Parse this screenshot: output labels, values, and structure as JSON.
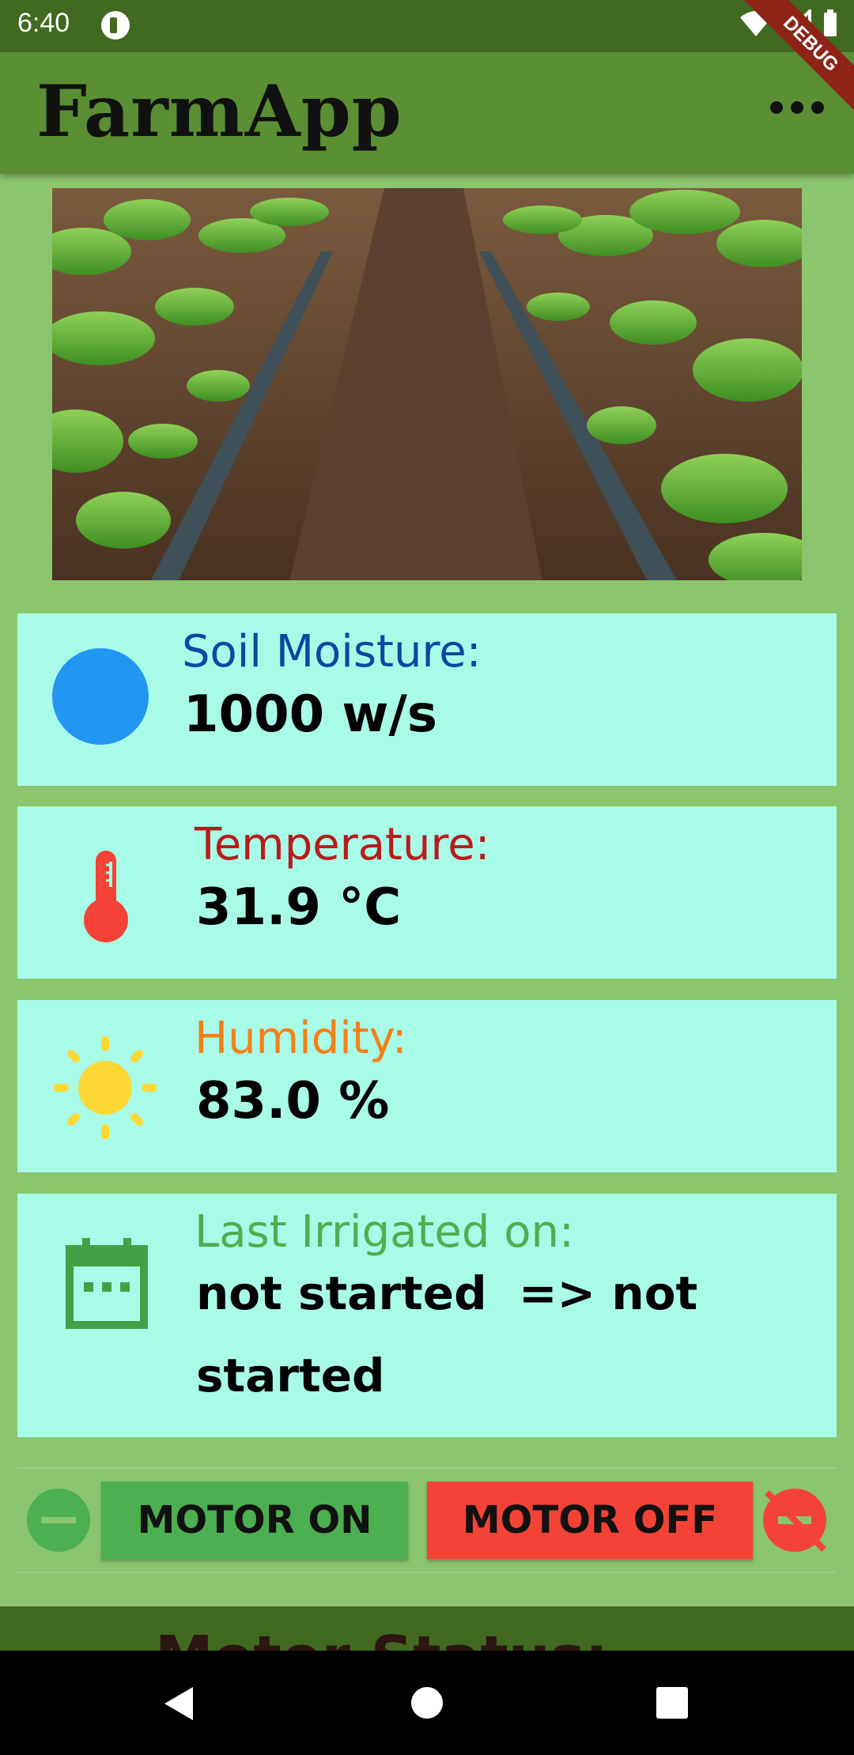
{
  "status_bar": {
    "time": "6:40",
    "debug_banner": "DEBUG"
  },
  "app_bar": {
    "title": "FarmApp",
    "menu_icon": "more-horiz-icon"
  },
  "hero_image": {
    "description": "crop-rows-drip-irrigation"
  },
  "cards": {
    "soil": {
      "label": "Soil Moisture:",
      "value": "1000 w/s",
      "label_color": "#0d47a1",
      "icon": "circle-icon",
      "icon_color": "#2196f3"
    },
    "temperature": {
      "label": "Temperature:",
      "value": "31.9 °C",
      "label_color": "#b71c1c",
      "icon": "thermometer-icon",
      "icon_color": "#f44336"
    },
    "humidity": {
      "label": "Humidity:",
      "value": "83.0 %",
      "label_color": "#f57f17",
      "icon": "sun-icon",
      "icon_color": "#fdd835"
    },
    "irrigation": {
      "label": "Last Irrigated on:",
      "value_line1": "not started  => not",
      "value_line2": "started",
      "label_color": "#4caf50",
      "icon": "calendar-icon",
      "icon_color": "#43a047"
    }
  },
  "motor_controls": {
    "on_label": "MOTOR ON",
    "off_label": "MOTOR OFF",
    "on_color": "#4caf50",
    "off_color": "#f44336"
  },
  "bottom_section": {
    "peek_text": "Motor Status:"
  }
}
